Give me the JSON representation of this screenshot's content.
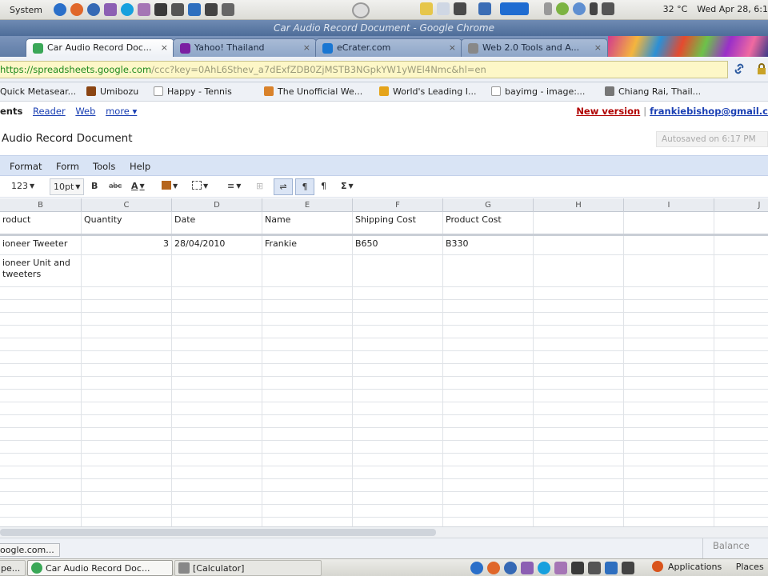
{
  "top_panel": {
    "system_menu": "System",
    "temperature": "32 °C",
    "datetime": "Wed Apr 28,  6:1"
  },
  "window": {
    "title": "Car Audio Record Document - Google Chrome"
  },
  "tabs": [
    {
      "label": "Car Audio Record Doc...",
      "favicon_color": "#3aa757"
    },
    {
      "label": "Yahoo! Thailand",
      "favicon_color": "#7b1fa2"
    },
    {
      "label": "eCrater.com",
      "favicon_color": "#1976d2"
    },
    {
      "label": "Web 2.0 Tools and A...",
      "favicon_color": "#888888"
    }
  ],
  "omnibox": {
    "scheme": "https://",
    "host": "spreadsheets.google.com",
    "path": "/ccc?key=0AhL6Sthev_a7dExfZDB0ZjMSTB3NGpkYW1yWEl4Nmc&hl=en"
  },
  "bookmarks": [
    "Quick Metasear...",
    "Umibozu",
    "Happy - Tennis",
    "The Unofficial We...",
    "World's Leading I...",
    "bayimg - image:...",
    "Chiang Rai, Thail..."
  ],
  "google_bar": {
    "current": "ents",
    "links": [
      "Reader",
      "Web",
      "more ▾"
    ],
    "new_version": "New version",
    "email": "frankiebishop@gmail.c"
  },
  "document": {
    "title": "Audio Record Document",
    "autosave": "Autosaved on 6:17 PM"
  },
  "menubar": [
    "Format",
    "Form",
    "Tools",
    "Help"
  ],
  "toolbar": {
    "number_format": "123",
    "font_size": "10pt",
    "bold": "B",
    "strike": "abc",
    "text_color": "A",
    "sum": "Σ"
  },
  "sheet": {
    "columns": [
      "B",
      "C",
      "D",
      "E",
      "F",
      "G",
      "H",
      "I",
      "J"
    ],
    "header_row": [
      "roduct",
      "Quantity",
      "Date",
      "Name",
      "Shipping Cost",
      "Product Cost",
      "",
      "",
      ""
    ],
    "rows": [
      [
        "ioneer Tweeter",
        "3",
        "28/04/2010",
        "Frankie",
        "B650",
        "B330",
        "",
        "",
        ""
      ],
      [
        "ioneer Unit and tweeters",
        "",
        "",
        "",
        "",
        "",
        "",
        "",
        ""
      ]
    ]
  },
  "status": {
    "hover_url": "oogle.com...",
    "balance_label": "Balance"
  },
  "taskbar": {
    "tasks": [
      "pe...",
      "Car Audio Record Doc...",
      "[Calculator]"
    ],
    "applications": "Applications",
    "places": "Places"
  }
}
